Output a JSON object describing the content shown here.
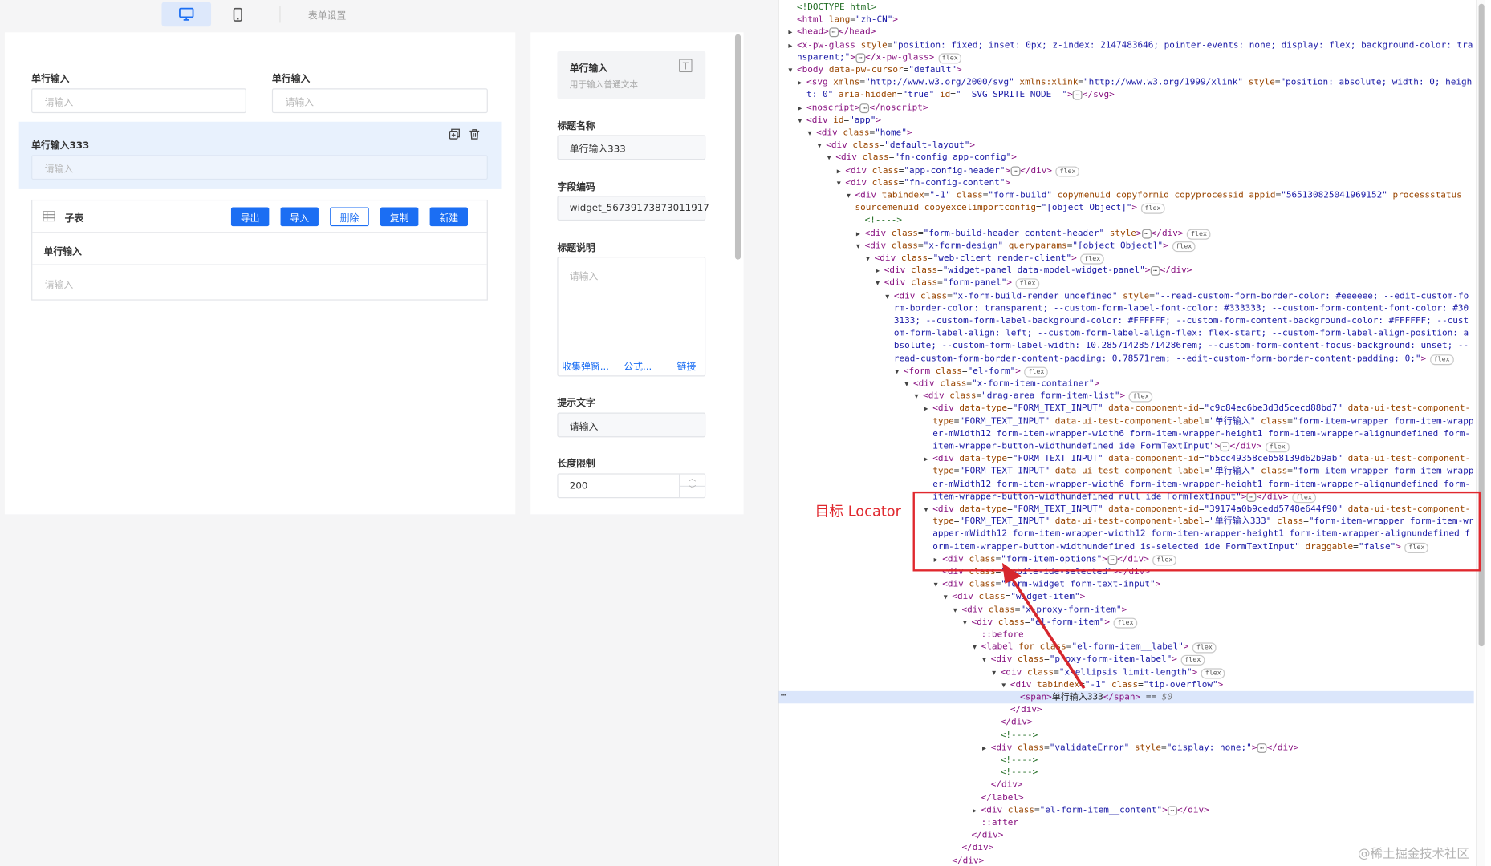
{
  "topbar": {
    "pc_icon": "desktop-monitor-icon",
    "mobile_icon": "mobile-phone-icon",
    "form_settings": "表单设置"
  },
  "canvas": {
    "field1_label": "单行输入",
    "field1_placeholder": "请输入",
    "field2_label": "单行输入",
    "field2_placeholder": "请输入",
    "selected_label": "单行输入333",
    "selected_placeholder": "请输入",
    "copy_icon": "copy-icon",
    "delete_icon": "trash-icon",
    "subtable": {
      "icon": "table-icon",
      "title": "子表",
      "buttons": [
        "导出",
        "导入",
        "删除",
        "复制",
        "新建"
      ],
      "column_label": "单行输入",
      "cell_placeholder": "请输入"
    }
  },
  "props": {
    "widget_name": "单行输入",
    "widget_desc": "用于输入普通文本",
    "widget_icon": "text-type-icon",
    "title_label": "标题名称",
    "title_value": "单行输入333",
    "code_label": "字段编码",
    "code_value": "widget_56739173873011917",
    "desc_label": "标题说明",
    "desc_placeholder": "请输入",
    "desc_links": [
      "收集弹窗...",
      "公式...",
      "链接"
    ],
    "hint_label": "提示文字",
    "hint_value": "请输入",
    "length_label": "长度限制",
    "length_value": "200"
  },
  "annotation": {
    "label": "目标 Locator"
  },
  "watermark": "@稀土掘金技术社区",
  "devtools_lines": [
    {
      "i": 0,
      "t": "",
      "h": "<span class=\"cm\">&lt;!DOCTYPE html&gt;</span>"
    },
    {
      "i": 0,
      "t": "",
      "h": "<span class=\"tag\">&lt;html</span> <span class=\"an\">lang</span>=<span class=\"av\">\"zh-CN\"</span><span class=\"tag\">&gt;</span>"
    },
    {
      "i": 0,
      "t": "▶",
      "h": "<span class=\"tag\">&lt;head&gt;</span><span class=\"ell\">⋯</span><span class=\"tag\">&lt;/head&gt;</span>"
    },
    {
      "i": 0,
      "t": "▶",
      "h": "<span class=\"tag\">&lt;x-pw-glass</span> <span class=\"an\">style</span>=<span class=\"av\">\"position: fixed; inset: 0px; z-index: 2147483646; pointer-events: none; display: flex; background-color: tra</span>"
    },
    {
      "i": 0,
      "t": "",
      "h": "<span class=\"av\">nsparent;\"</span><span class=\"tag\">&gt;</span><span class=\"ell\">⋯</span><span class=\"tag\">&lt;/x-pw-glass&gt;</span><span class=\"badge\">flex</span>"
    },
    {
      "i": 0,
      "t": "▼",
      "h": "<span class=\"tag\">&lt;body</span> <span class=\"an\">data-pw-cursor</span>=<span class=\"av\">\"default\"</span><span class=\"tag\">&gt;</span>"
    },
    {
      "i": 1,
      "t": "▶",
      "h": "<span class=\"tag\">&lt;svg</span> <span class=\"an\">xmlns</span>=<span class=\"av\">\"http://www.w3.org/2000/svg\"</span> <span class=\"an\">xmlns:xlink</span>=<span class=\"av\">\"http://www.w3.org/1999/xlink\"</span> <span class=\"an\">style</span>=<span class=\"av\">\"position: absolute; width: 0; heigh</span>"
    },
    {
      "i": 1,
      "t": "",
      "h": "<span class=\"av\">t: 0\"</span> <span class=\"an\">aria-hidden</span>=<span class=\"av\">\"true\"</span> <span class=\"an\">id</span>=<span class=\"av\">\"__SVG_SPRITE_NODE__\"</span><span class=\"tag\">&gt;</span><span class=\"ell\">⋯</span><span class=\"tag\">&lt;/svg&gt;</span>"
    },
    {
      "i": 1,
      "t": "▶",
      "h": "<span class=\"tag\">&lt;noscript&gt;</span><span class=\"ell\">⋯</span><span class=\"tag\">&lt;/noscript&gt;</span>"
    },
    {
      "i": 1,
      "t": "▼",
      "h": "<span class=\"tag\">&lt;div</span> <span class=\"an\">id</span>=<span class=\"av\">\"app\"</span><span class=\"tag\">&gt;</span>"
    },
    {
      "i": 2,
      "t": "▼",
      "h": "<span class=\"tag\">&lt;div</span> <span class=\"an\">class</span>=<span class=\"av\">\"home\"</span><span class=\"tag\">&gt;</span>"
    },
    {
      "i": 3,
      "t": "▼",
      "h": "<span class=\"tag\">&lt;div</span> <span class=\"an\">class</span>=<span class=\"av\">\"default-layout\"</span><span class=\"tag\">&gt;</span>"
    },
    {
      "i": 4,
      "t": "▼",
      "h": "<span class=\"tag\">&lt;div</span> <span class=\"an\">class</span>=<span class=\"av\">\"fn-config app-config\"</span><span class=\"tag\">&gt;</span>"
    },
    {
      "i": 5,
      "t": "▶",
      "h": "<span class=\"tag\">&lt;div</span> <span class=\"an\">class</span>=<span class=\"av\">\"app-config-header\"</span><span class=\"tag\">&gt;</span><span class=\"ell\">⋯</span><span class=\"tag\">&lt;/div&gt;</span><span class=\"badge\">flex</span>"
    },
    {
      "i": 5,
      "t": "▼",
      "h": "<span class=\"tag\">&lt;div</span> <span class=\"an\">class</span>=<span class=\"av\">\"fn-config-content\"</span><span class=\"tag\">&gt;</span>"
    },
    {
      "i": 6,
      "t": "▼",
      "h": "<span class=\"tag\">&lt;div</span> <span class=\"an\">tabindex</span>=<span class=\"av\">\"-1\"</span> <span class=\"an\">class</span>=<span class=\"av\">\"form-build\"</span> <span class=\"an\">copymenuid copyformid copyprocessid appid</span>=<span class=\"av\">\"565130825041969152\"</span> <span class=\"an\">processstatus</span>"
    },
    {
      "i": 6,
      "t": "",
      "h": "<span class=\"an\">sourcemenuid copyexcelimportconfig</span>=<span class=\"av\">\"[object Object]\"</span><span class=\"tag\">&gt;</span><span class=\"badge\">flex</span>"
    },
    {
      "i": 7,
      "t": "",
      "h": "<span class=\"cm\">&lt;!----&gt;</span>"
    },
    {
      "i": 7,
      "t": "▶",
      "h": "<span class=\"tag\">&lt;div</span> <span class=\"an\">class</span>=<span class=\"av\">\"form-build-header content-header\"</span> <span class=\"an\">style</span><span class=\"tag\">&gt;</span><span class=\"ell\">⋯</span><span class=\"tag\">&lt;/div&gt;</span><span class=\"badge\">flex</span>"
    },
    {
      "i": 7,
      "t": "▼",
      "h": "<span class=\"tag\">&lt;div</span> <span class=\"an\">class</span>=<span class=\"av\">\"x-form-design\"</span> <span class=\"an\">queryparams</span>=<span class=\"av\">\"[object Object]\"</span><span class=\"tag\">&gt;</span><span class=\"badge\">flex</span>"
    },
    {
      "i": 8,
      "t": "▼",
      "h": "<span class=\"tag\">&lt;div</span> <span class=\"an\">class</span>=<span class=\"av\">\"web-client render-client\"</span><span class=\"tag\">&gt;</span><span class=\"badge\">flex</span>"
    },
    {
      "i": 9,
      "t": "▶",
      "h": "<span class=\"tag\">&lt;div</span> <span class=\"an\">class</span>=<span class=\"av\">\"widget-panel data-model-widget-panel\"</span><span class=\"tag\">&gt;</span><span class=\"ell\">⋯</span><span class=\"tag\">&lt;/div&gt;</span>"
    },
    {
      "i": 9,
      "t": "▼",
      "h": "<span class=\"tag\">&lt;div</span> <span class=\"an\">class</span>=<span class=\"av\">\"form-panel\"</span><span class=\"tag\">&gt;</span><span class=\"badge\">flex</span>"
    },
    {
      "i": 10,
      "t": "▼",
      "h": "<span class=\"tag\">&lt;div</span> <span class=\"an\">class</span>=<span class=\"av\">\"x-form-build-render undefined\"</span> <span class=\"an\">style</span>=<span class=\"av\">\"--read-custom-form-border-color: #eeeeee; --edit-custom-fo</span>"
    },
    {
      "i": 10,
      "t": "",
      "h": "<span class=\"av\">rm-border-color: transparent; --custom-form-label-font-color: #333333; --custom-form-content-font-color: #30</span>"
    },
    {
      "i": 10,
      "t": "",
      "h": "<span class=\"av\">3133; --custom-form-label-background-color: #FFFFFF; --custom-form-content-background-color: #FFFFFF; --cust</span>"
    },
    {
      "i": 10,
      "t": "",
      "h": "<span class=\"av\">om-form-label-align: left; --custom-form-label-align-flex: flex-start; --custom-form-label-align-position: a</span>"
    },
    {
      "i": 10,
      "t": "",
      "h": "<span class=\"av\">bsolute; --custom-form-label-width: 10.285714285714286rem; --custom-form-content-focus-background: unset; --</span>"
    },
    {
      "i": 10,
      "t": "",
      "h": "<span class=\"av\">read-custom-form-border-content-padding: 0.78571rem; --edit-custom-form-border-content-padding: 0;\"</span><span class=\"tag\">&gt;</span><span class=\"badge\">flex</span>"
    },
    {
      "i": 11,
      "t": "▼",
      "h": "<span class=\"tag\">&lt;form</span> <span class=\"an\">class</span>=<span class=\"av\">\"el-form\"</span><span class=\"tag\">&gt;</span><span class=\"badge\">flex</span>"
    },
    {
      "i": 12,
      "t": "▼",
      "h": "<span class=\"tag\">&lt;div</span> <span class=\"an\">class</span>=<span class=\"av\">\"x-form-item-container\"</span><span class=\"tag\">&gt;</span>"
    },
    {
      "i": 13,
      "t": "▼",
      "h": "<span class=\"tag\">&lt;div</span> <span class=\"an\">class</span>=<span class=\"av\">\"drag-area form-item-list\"</span><span class=\"tag\">&gt;</span><span class=\"badge\">flex</span>"
    },
    {
      "i": 14,
      "t": "▶",
      "h": "<span class=\"tag\">&lt;div</span> <span class=\"an\">data-type</span>=<span class=\"av\">\"FORM_TEXT_INPUT\"</span> <span class=\"an\">data-component-id</span>=<span class=\"av\">\"c9c84ec6be3d3d5cecd88bd7\"</span> <span class=\"an\">data-ui-test-component-</span>"
    },
    {
      "i": 14,
      "t": "",
      "h": "<span class=\"an\">type</span>=<span class=\"av\">\"FORM_TEXT_INPUT\"</span> <span class=\"an\">data-ui-test-component-label</span>=<span class=\"av\">\"单行输入\"</span> <span class=\"an\">class</span>=<span class=\"av\">\"form-item-wrapper form-item-wrapp</span>"
    },
    {
      "i": 14,
      "t": "",
      "h": "<span class=\"av\">er-mWidth12 form-item-wrapper-width6 form-item-wrapper-height1 form-item-wrapper-alignundefined form-</span>"
    },
    {
      "i": 14,
      "t": "",
      "h": "<span class=\"av\">item-wrapper-button-widthundefined  ide FormTextInput\"</span><span class=\"tag\">&gt;</span><span class=\"ell\">⋯</span><span class=\"tag\">&lt;/div&gt;</span><span class=\"badge\">flex</span>"
    },
    {
      "i": 14,
      "t": "▶",
      "h": "<span class=\"tag\">&lt;div</span> <span class=\"an\">data-type</span>=<span class=\"av\">\"FORM_TEXT_INPUT\"</span> <span class=\"an\">data-component-id</span>=<span class=\"av\">\"b5cc49358ceb58139d62b9ab\"</span> <span class=\"an\">data-ui-test-component-</span>"
    },
    {
      "i": 14,
      "t": "",
      "h": "<span class=\"an\">type</span>=<span class=\"av\">\"FORM_TEXT_INPUT\"</span> <span class=\"an\">data-ui-test-component-label</span>=<span class=\"av\">\"单行输入\"</span> <span class=\"an\">class</span>=<span class=\"av\">\"form-item-wrapper form-item-wrapp</span>"
    },
    {
      "i": 14,
      "t": "",
      "h": "<span class=\"av\">er-mWidth12 form-item-wrapper-width6 form-item-wrapper-height1 form-item-wrapper-alignundefined form-</span>"
    },
    {
      "i": 14,
      "t": "",
      "h": "<span class=\"av\">item-wrapper-button-widthundefined null ide FormTextInput\"</span><span class=\"tag\">&gt;</span><span class=\"ell\">⋯</span><span class=\"tag\">&lt;/div&gt;</span><span class=\"badge\">flex</span>"
    },
    {
      "i": 14,
      "t": "▼",
      "h": "<span class=\"tag\">&lt;div</span> <span class=\"an\">data-type</span>=<span class=\"av\">\"FORM_TEXT_INPUT\"</span> <span class=\"an\">data-component-id</span>=<span class=\"av\">\"39174a0b9cedd5748e644f90\"</span> <span class=\"an\">data-ui-test-component-</span>"
    },
    {
      "i": 14,
      "t": "",
      "h": "<span class=\"an\">type</span>=<span class=\"av\">\"FORM_TEXT_INPUT\"</span> <span class=\"an\">data-ui-test-component-label</span>=<span class=\"av\">\"单行输入333\"</span> <span class=\"an\">class</span>=<span class=\"av\">\"form-item-wrapper form-item-wr</span>"
    },
    {
      "i": 14,
      "t": "",
      "h": "<span class=\"av\">apper-mWidth12 form-item-wrapper-width12 form-item-wrapper-height1 form-item-wrapper-alignundefined f</span>"
    },
    {
      "i": 14,
      "t": "",
      "h": "<span class=\"av\">orm-item-wrapper-button-widthundefined is-selected ide FormTextInput\"</span> <span class=\"an\">draggable</span>=<span class=\"av\">\"false\"</span><span class=\"tag\">&gt;</span><span class=\"badge\">flex</span>"
    },
    {
      "i": 15,
      "t": "▶",
      "h": "<span class=\"tag\">&lt;div</span> <span class=\"an\">class</span>=<span class=\"av\">\"form-item-options\"</span><span class=\"tag\">&gt;</span><span class=\"ell\">⋯</span><span class=\"tag\">&lt;/div&gt;</span><span class=\"badge\">flex</span>"
    },
    {
      "i": 15,
      "t": "",
      "h": "<span class=\"tag\">&lt;div</span> <span class=\"an\">class</span>=<span class=\"av\">\"mobile-ide-selected\"</span><span class=\"tag\">&gt;&lt;/div&gt;</span>"
    },
    {
      "i": 15,
      "t": "▼",
      "h": "<span class=\"tag\">&lt;div</span> <span class=\"an\">class</span>=<span class=\"av\">\"form-widget form-text-input\"</span><span class=\"tag\">&gt;</span>"
    },
    {
      "i": 16,
      "t": "▼",
      "h": "<span class=\"tag\">&lt;div</span> <span class=\"an\">class</span>=<span class=\"av\">\"widget-item\"</span><span class=\"tag\">&gt;</span>"
    },
    {
      "i": 17,
      "t": "▼",
      "h": "<span class=\"tag\">&lt;div</span> <span class=\"an\">class</span>=<span class=\"av\">\"x-proxy-form-item\"</span><span class=\"tag\">&gt;</span>"
    },
    {
      "i": 18,
      "t": "▼",
      "h": "<span class=\"tag\">&lt;div</span> <span class=\"an\">class</span>=<span class=\"av\">\"el-form-item\"</span><span class=\"tag\">&gt;</span><span class=\"badge\">flex</span>"
    },
    {
      "i": 19,
      "t": "",
      "h": "<span class=\"tag\">::before</span>"
    },
    {
      "i": 19,
      "t": "▼",
      "h": "<span class=\"tag\">&lt;label</span> <span class=\"an\">for</span> <span class=\"an\">class</span>=<span class=\"av\">\"el-form-item__label\"</span><span class=\"tag\">&gt;</span><span class=\"badge\">flex</span>"
    },
    {
      "i": 20,
      "t": "▼",
      "h": "<span class=\"tag\">&lt;div</span> <span class=\"an\">class</span>=<span class=\"av\">\"proxy-form-item-label\"</span><span class=\"tag\">&gt;</span><span class=\"badge\">flex</span>"
    },
    {
      "i": 21,
      "t": "▼",
      "h": "<span class=\"tag\">&lt;div</span> <span class=\"an\">class</span>=<span class=\"av\">\"x-ellipsis limit-length\"</span><span class=\"tag\">&gt;</span><span class=\"badge\">flex</span>"
    },
    {
      "i": 22,
      "t": "▼",
      "h": "<span class=\"tag\">&lt;div</span> <span class=\"an\">tabindex</span>=<span class=\"av\">\"-1\"</span> <span class=\"an\">class</span>=<span class=\"av\">\"tip-overflow\"</span><span class=\"tag\">&gt;</span>"
    },
    {
      "i": 23,
      "t": "",
      "h": "<span class=\"tag\">&lt;span&gt;</span>单行输入333<span class=\"tag\">&lt;/span&gt;</span> == <span style=\"color:#777;font-style:italic\">$0</span>"
    },
    {
      "i": 22,
      "t": "",
      "h": "<span class=\"tag\">&lt;/div&gt;</span>"
    },
    {
      "i": 21,
      "t": "",
      "h": "<span class=\"tag\">&lt;/div&gt;</span>"
    },
    {
      "i": 21,
      "t": "",
      "h": "<span class=\"cm\">&lt;!----&gt;</span>"
    },
    {
      "i": 20,
      "t": "▶",
      "h": "<span class=\"tag\">&lt;div</span> <span class=\"an\">class</span>=<span class=\"av\">\"validateError\"</span> <span class=\"an\">style</span>=<span class=\"av\">\"display: none;\"</span><span class=\"tag\">&gt;</span><span class=\"ell\">⋯</span><span class=\"tag\">&lt;/div&gt;</span>"
    },
    {
      "i": 21,
      "t": "",
      "h": "<span class=\"cm\">&lt;!----&gt;</span>"
    },
    {
      "i": 21,
      "t": "",
      "h": "<span class=\"cm\">&lt;!----&gt;</span>"
    },
    {
      "i": 20,
      "t": "",
      "h": "<span class=\"tag\">&lt;/div&gt;</span>"
    },
    {
      "i": 19,
      "t": "",
      "h": "<span class=\"tag\">&lt;/label&gt;</span>"
    },
    {
      "i": 19,
      "t": "▶",
      "h": "<span class=\"tag\">&lt;div</span> <span class=\"an\">class</span>=<span class=\"av\">\"el-form-item__content\"</span><span class=\"tag\">&gt;</span><span class=\"ell\">⋯</span><span class=\"tag\">&lt;/div&gt;</span>"
    },
    {
      "i": 19,
      "t": "",
      "h": "<span class=\"tag\">::after</span>"
    },
    {
      "i": 18,
      "t": "",
      "h": "<span class=\"tag\">&lt;/div&gt;</span>"
    },
    {
      "i": 17,
      "t": "",
      "h": "<span class=\"tag\">&lt;/div&gt;</span>"
    },
    {
      "i": 16,
      "t": "",
      "h": "<span class=\"tag\">&lt;/div&gt;</span>"
    }
  ]
}
